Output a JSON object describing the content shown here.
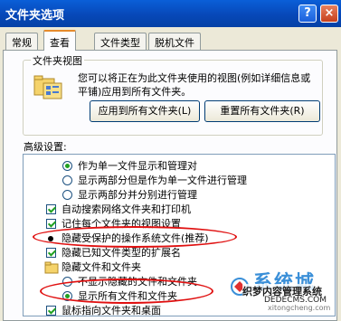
{
  "window": {
    "title": "文件夹选项",
    "help_label": "?",
    "close_label": "×"
  },
  "tabs": [
    {
      "label": "常规",
      "active": false
    },
    {
      "label": "查看",
      "active": true
    },
    {
      "label": "文件类型",
      "active": false
    },
    {
      "label": "脱机文件",
      "active": false
    }
  ],
  "folder_views": {
    "title": "文件夹视图",
    "description": "您可以将正在为此文件夹使用的视图(例如详细信息或平铺)应用到所有文件夹。",
    "apply_button": "应用到所有文件夹(L)",
    "reset_button": "重置所有文件夹(R)"
  },
  "advanced": {
    "label": "高级设置:",
    "items": [
      {
        "type": "radio",
        "checked": true,
        "label": "作为单一文件显示和管理对"
      },
      {
        "type": "radio",
        "checked": false,
        "label": "显示两部分但是作为单一文件进行管理"
      },
      {
        "type": "radio",
        "checked": false,
        "label": "显示两部分并分别进行管理"
      },
      {
        "type": "checkbox",
        "checked": true,
        "label": "自动搜索网络文件夹和打印机"
      },
      {
        "type": "checkbox",
        "checked": true,
        "label": "记住每个文件夹的视图设置"
      },
      {
        "type": "bullet",
        "checked": false,
        "label": "隐藏受保护的操作系统文件(推荐)"
      },
      {
        "type": "checkbox",
        "checked": true,
        "label": "隐藏已知文件类型的扩展名"
      },
      {
        "type": "folder",
        "checked": false,
        "label": "隐藏文件和文件夹"
      },
      {
        "type": "radio",
        "checked": false,
        "label": "不显示隐藏的文件和文件夹"
      },
      {
        "type": "radio",
        "checked": true,
        "label": "显示所有文件和文件夹"
      },
      {
        "type": "checkbox",
        "checked": true,
        "label": "鼠标指向文件夹和桌面"
      }
    ]
  },
  "watermark": {
    "brand": "系统城",
    "site_name": "织梦内容管理系统",
    "url": "DEDECMS.COM",
    "bottom_text": "xitongcheng.com"
  },
  "colors": {
    "titlebar": "#0748b8",
    "highlight_ellipse": "#e01010",
    "check_mark": "#21a121"
  }
}
